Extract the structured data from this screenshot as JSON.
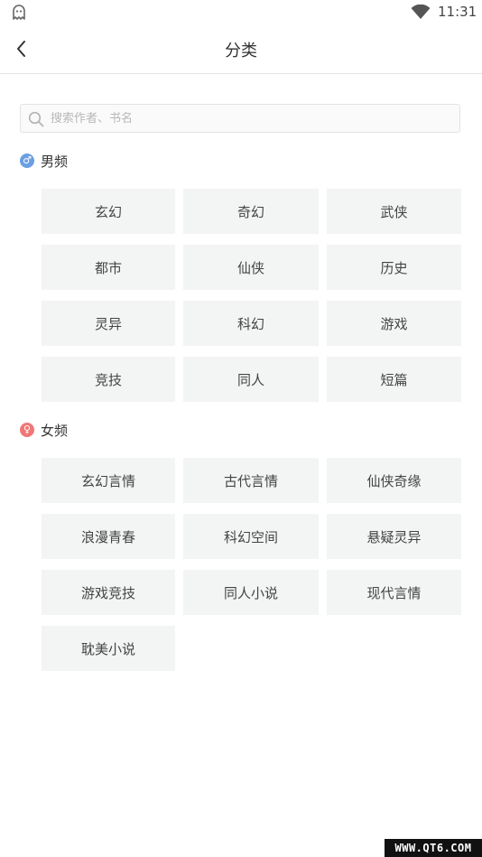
{
  "status_bar": {
    "app_icon": "ghost-notification-icon",
    "wifi_icon": "wifi-icon",
    "time": "11:31"
  },
  "header": {
    "back_icon": "chevron-left-icon",
    "title": "分类"
  },
  "search": {
    "icon": "search-icon",
    "placeholder": "搜索作者、书名",
    "value": ""
  },
  "sections": {
    "male": {
      "icon": "male-symbol-icon",
      "badge_color": "#6b9fe3",
      "label": "男频",
      "items": [
        "玄幻",
        "奇幻",
        "武侠",
        "都市",
        "仙侠",
        "历史",
        "灵异",
        "科幻",
        "游戏",
        "竞技",
        "同人",
        "短篇"
      ]
    },
    "female": {
      "icon": "female-symbol-icon",
      "badge_color": "#ef7777",
      "label": "女频",
      "items": [
        "玄幻言情",
        "古代言情",
        "仙侠奇缘",
        "浪漫青春",
        "科幻空间",
        "悬疑灵异",
        "游戏竞技",
        "同人小说",
        "现代言情",
        "耽美小说"
      ]
    }
  },
  "watermark": "WWW.QT6.COM"
}
